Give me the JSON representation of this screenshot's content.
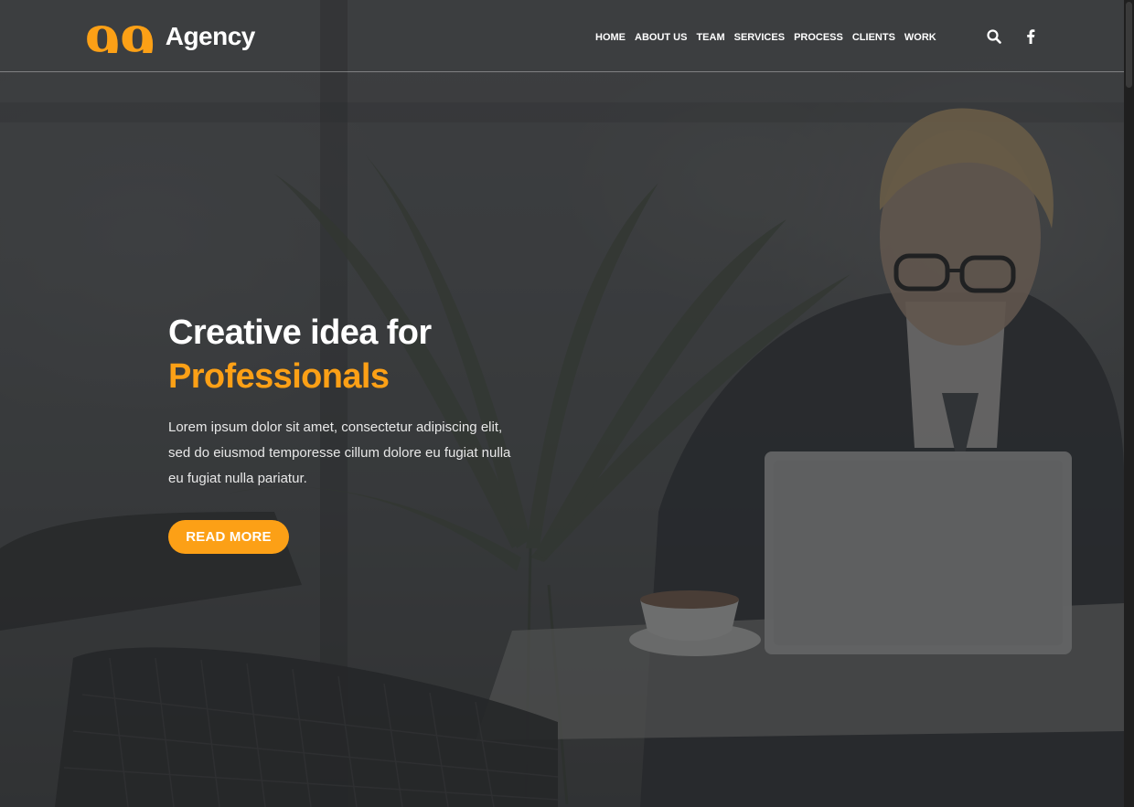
{
  "colors": {
    "accent": "#fca016",
    "heading": "#ffffff",
    "overlay": "#2a2b2d"
  },
  "header": {
    "logo_text": "Agency",
    "logo_mark": "99",
    "nav": [
      {
        "label": "HOME"
      },
      {
        "label": "ABOUT US"
      },
      {
        "label": "TEAM"
      },
      {
        "label": "SERVICES"
      },
      {
        "label": "PROCESS"
      },
      {
        "label": "CLIENTS"
      },
      {
        "label": "WORK"
      }
    ],
    "icons": [
      "search-icon",
      "facebook-icon"
    ]
  },
  "hero": {
    "title_line1": "Creative idea for",
    "title_line2": "Professionals",
    "body": "Lorem ipsum dolor sit amet, consectetur adipiscing elit, sed do eiusmod temporesse cillum dolore eu fugiat nulla eu fugiat nulla pariatur.",
    "button_label": "READ MORE"
  }
}
